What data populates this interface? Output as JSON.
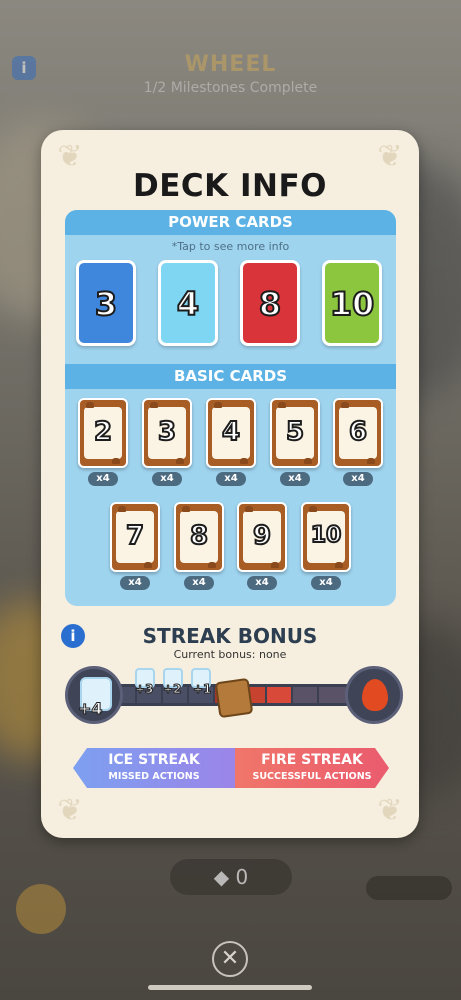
{
  "background": {
    "title": "WHEEL",
    "subtitle": "1/2 Milestones Complete",
    "counter": "0"
  },
  "modal": {
    "title": "DECK INFO",
    "power_cards": {
      "header": "POWER CARDS",
      "note": "*Tap to see more info",
      "cards": [
        {
          "value": "3",
          "color": "#3f86dd"
        },
        {
          "value": "4",
          "color": "#7fd6f2"
        },
        {
          "value": "8",
          "color": "#d8343a"
        },
        {
          "value": "10",
          "color": "#8cc63e"
        }
      ]
    },
    "basic_cards": {
      "header": "BASIC CARDS",
      "cards": [
        {
          "value": "2",
          "count": "x4"
        },
        {
          "value": "3",
          "count": "x4"
        },
        {
          "value": "4",
          "count": "x4"
        },
        {
          "value": "5",
          "count": "x4"
        },
        {
          "value": "6",
          "count": "x4"
        },
        {
          "value": "7",
          "count": "x4"
        },
        {
          "value": "8",
          "count": "x4"
        },
        {
          "value": "9",
          "count": "x4"
        },
        {
          "value": "10",
          "count": "x4"
        }
      ]
    },
    "streak": {
      "title": "STREAK BONUS",
      "current": "Current bonus: none",
      "ice_bonus": "+4",
      "levels": [
        "+3",
        "+2",
        "+1"
      ],
      "ice_button": {
        "label": "ICE STREAK",
        "sub": "MISSED ACTIONS"
      },
      "fire_button": {
        "label": "FIRE STREAK",
        "sub": "SUCCESSFUL ACTIONS"
      }
    }
  },
  "colors": {
    "panel": "#9fd4ef",
    "band": "#5cb2e4",
    "basic_card": "#a75d23",
    "ice": "#7da0f0",
    "fire": "#ea5b6e"
  }
}
